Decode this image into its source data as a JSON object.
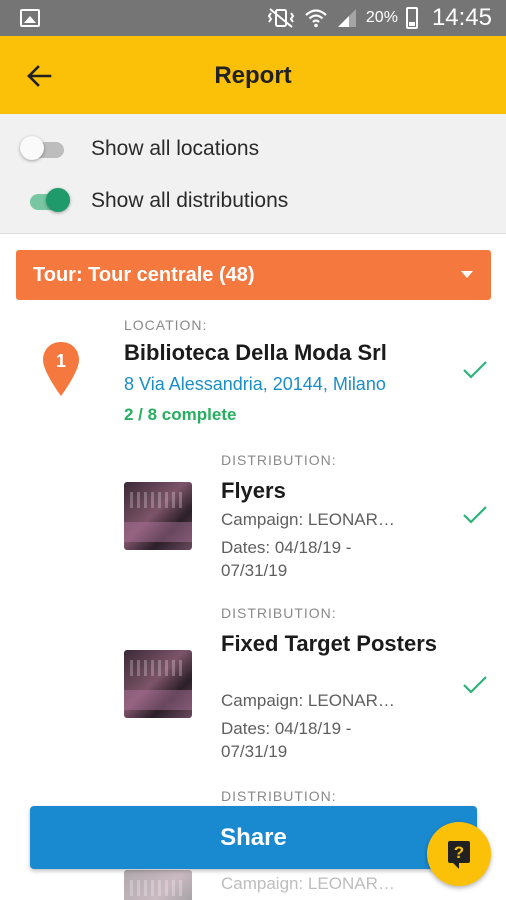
{
  "status_bar": {
    "battery_percent": "20%",
    "time": "14:45"
  },
  "app_bar": {
    "title": "Report"
  },
  "toggles": [
    {
      "label": "Show all locations",
      "on": false
    },
    {
      "label": "Show all distributions",
      "on": true
    }
  ],
  "tour": {
    "label": "Tour: Tour centrale (48)"
  },
  "location": {
    "caption": "LOCATION:",
    "pin_number": "1",
    "name": "Biblioteca Della Moda Srl",
    "address": "8 Via Alessandria, 20144, Milano",
    "progress": "2 / 8 complete"
  },
  "distributions": [
    {
      "caption": "DISTRIBUTION:",
      "name": "Flyers",
      "campaign": "Campaign: LEONAR…",
      "dates": "Dates: 04/18/19 - 07/31/19"
    },
    {
      "caption": "DISTRIBUTION:",
      "name": "Fixed Target Posters",
      "campaign": "Campaign: LEONAR…",
      "dates": "Dates: 04/18/19 - 07/31/19"
    },
    {
      "caption": "DISTRIBUTION:",
      "campaign": "Campaign: LEONAR…"
    }
  ],
  "share_button": {
    "label": "Share"
  },
  "colors": {
    "app_bar": "#fbc108",
    "tour_bar": "#f5783f",
    "share": "#1a8ad0",
    "complete": "#27ae60",
    "address": "#1a8ec6"
  }
}
